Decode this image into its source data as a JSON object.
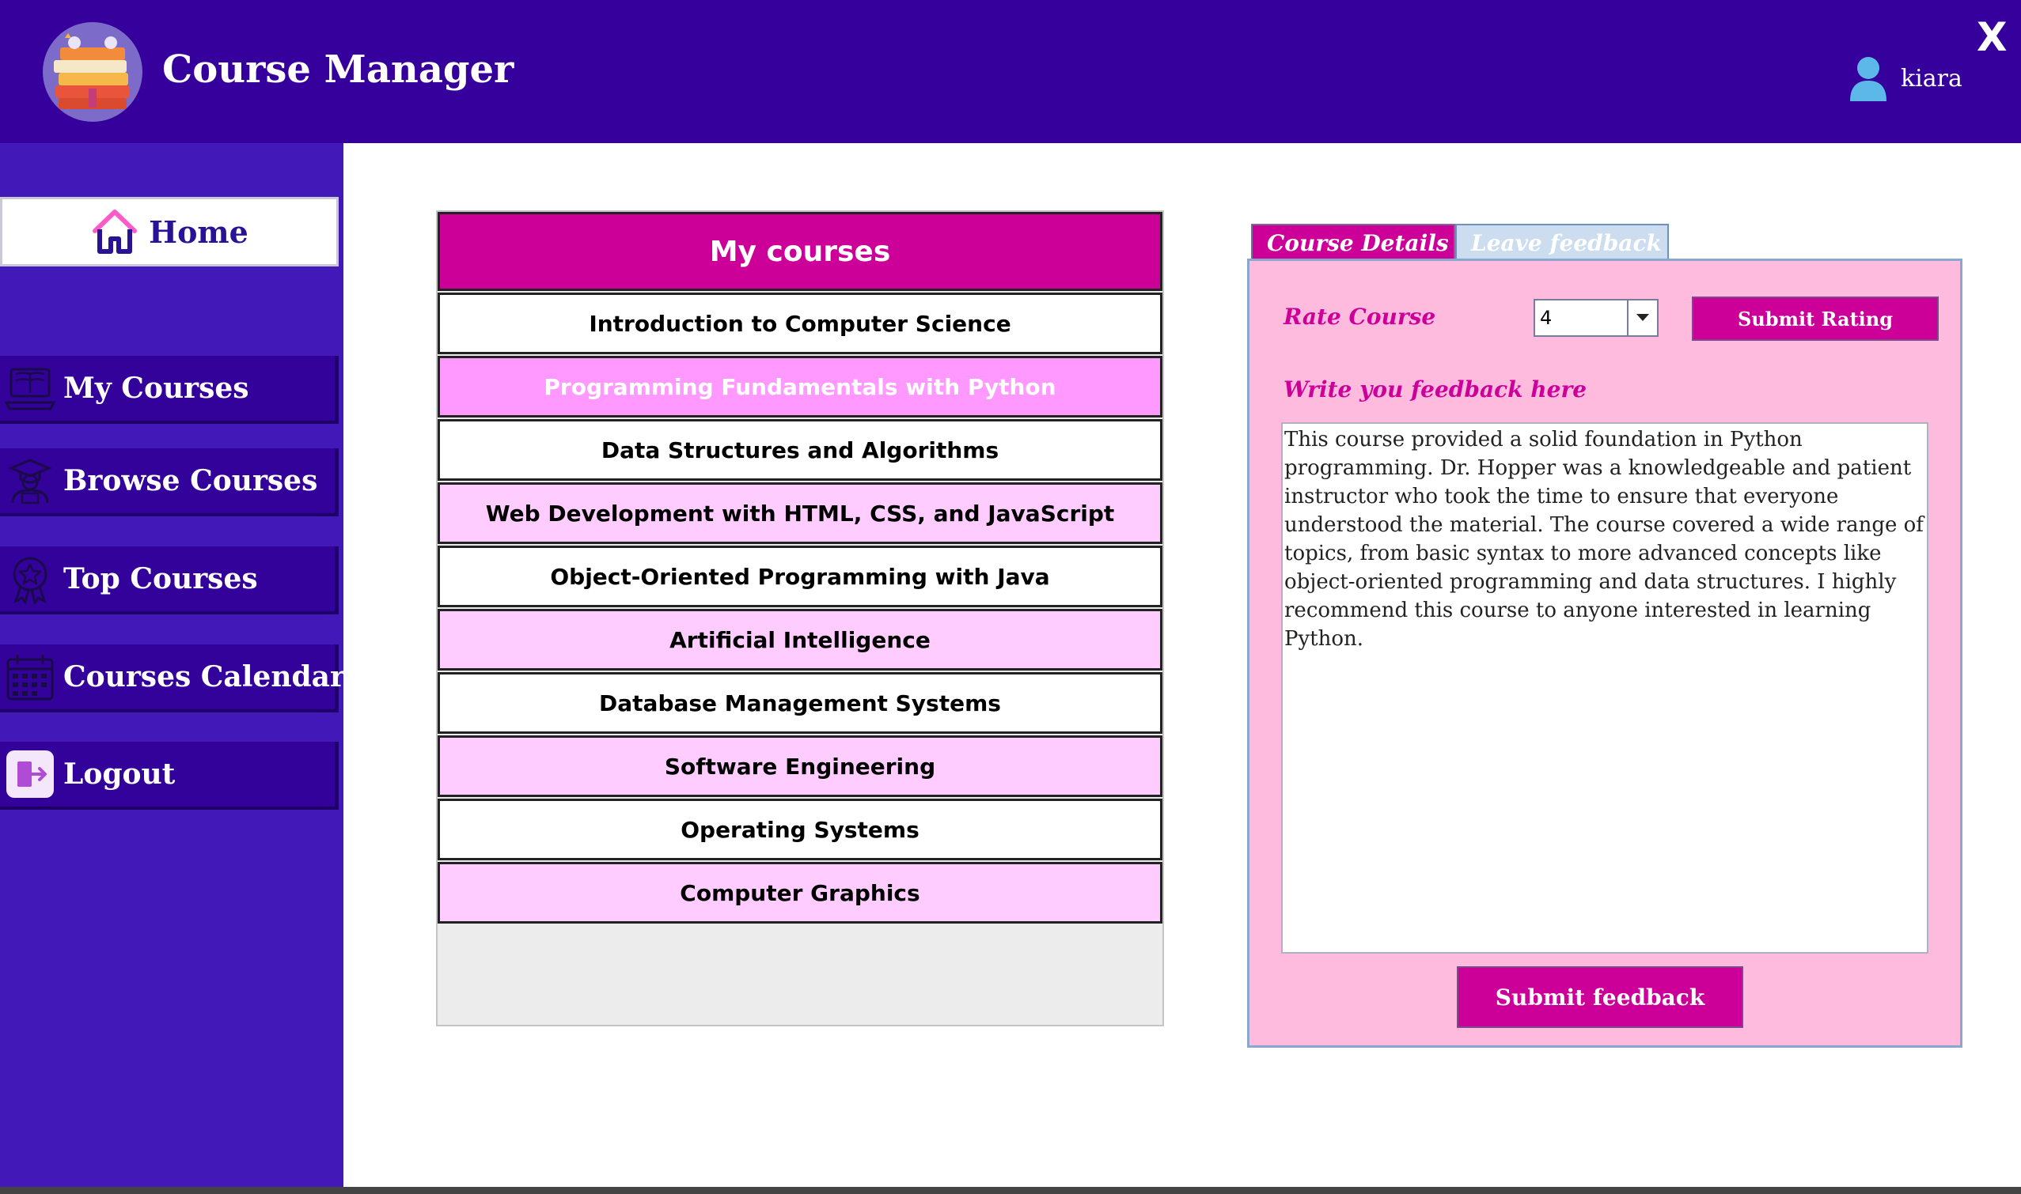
{
  "header": {
    "app_title": "Course Manager",
    "user_name": "kiara",
    "close_label": "X"
  },
  "sidebar": {
    "home_label": "Home",
    "items": [
      {
        "label": "My Courses",
        "icon": "book-laptop-icon"
      },
      {
        "label": "Browse Courses",
        "icon": "graduate-icon"
      },
      {
        "label": "Top Courses",
        "icon": "award-icon"
      },
      {
        "label": "Courses Calendar",
        "icon": "calendar-icon"
      },
      {
        "label": "Logout",
        "icon": "logout-icon"
      }
    ]
  },
  "courses": {
    "title": "My courses",
    "items": [
      "Introduction to Computer Science",
      "Programming Fundamentals with Python",
      "Data Structures and Algorithms",
      "Web Development with HTML, CSS, and JavaScript",
      "Object-Oriented Programming with Java",
      "Artificial Intelligence",
      "Database Management Systems",
      "Software Engineering",
      "Operating Systems",
      "Computer Graphics"
    ],
    "selected_index": 1
  },
  "tabs": {
    "course_details": "Course Details",
    "leave_feedback": "Leave feedback"
  },
  "feedback": {
    "rate_label": "Rate Course",
    "rate_value": "4",
    "submit_rating_label": "Submit Rating",
    "feedback_label": "Write you feedback here",
    "feedback_text": "This course provided a solid foundation in Python programming. Dr. Hopper was a knowledgeable and patient instructor who took the time to ensure that everyone understood the material. The course covered a wide range of topics, from basic syntax to more advanced concepts like object-oriented programming and data structures. I highly recommend this course to anyone interested in learning Python.",
    "submit_feedback_label": "Submit feedback"
  },
  "colors": {
    "header_bg": "#36009c",
    "sidebar_bg": "#4219b8",
    "accent_magenta": "#cc0099",
    "row_pink": "#ffccff",
    "row_selected": "#ff99ff",
    "panel_pink": "#ffbbdd"
  }
}
